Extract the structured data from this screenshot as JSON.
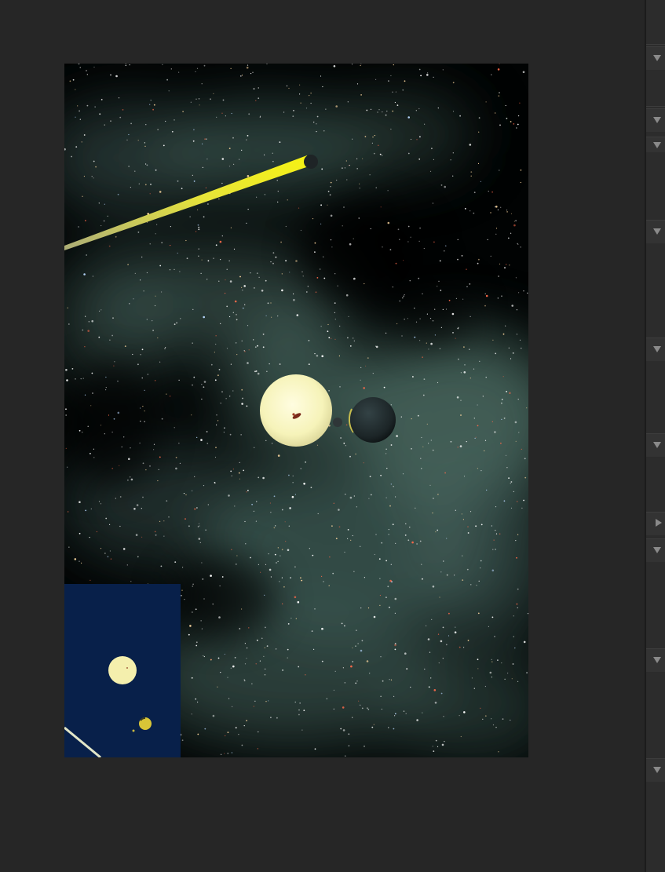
{
  "app": {
    "background": "#262626",
    "viewport_background": "#010303"
  },
  "viewport": {
    "name": "scene-viewport",
    "nebula_color": "#4f7068",
    "star_colors": [
      "#ffffff",
      "#ffd9a0",
      "#ff6a4a",
      "#b9d8ff"
    ],
    "objects": [
      {
        "name": "sun-sphere",
        "color": "#f6f3b9"
      },
      {
        "name": "dark-planet-sphere",
        "color": "#1f2a2c"
      },
      {
        "name": "small-moon-sphere",
        "color": "#2f3638"
      },
      {
        "name": "comet",
        "color": "#f2ee13"
      }
    ]
  },
  "minimap": {
    "background": "#08204a",
    "objects": [
      {
        "name": "minimap-sun-icon",
        "color": "#f4efad"
      },
      {
        "name": "minimap-planet-icon",
        "color": "#d8c537"
      },
      {
        "name": "minimap-comet-trail",
        "color": "#e2e6c8"
      }
    ]
  },
  "side_panel": {
    "sections": [
      {
        "name": "panel-section-1",
        "state": "expanded",
        "icon": "chevron-down-icon"
      },
      {
        "name": "panel-section-2",
        "state": "expanded",
        "icon": "chevron-down-icon"
      },
      {
        "name": "panel-section-3",
        "state": "expanded",
        "icon": "chevron-down-icon"
      },
      {
        "name": "panel-section-4",
        "state": "expanded",
        "icon": "chevron-down-icon"
      },
      {
        "name": "panel-section-5",
        "state": "expanded",
        "icon": "chevron-down-icon"
      },
      {
        "name": "panel-section-6",
        "state": "expanded",
        "icon": "chevron-down-icon"
      },
      {
        "name": "panel-section-7",
        "state": "collapsed",
        "icon": "chevron-right-icon"
      },
      {
        "name": "panel-section-8",
        "state": "expanded",
        "icon": "chevron-down-icon"
      },
      {
        "name": "panel-section-9",
        "state": "expanded",
        "icon": "chevron-down-icon"
      },
      {
        "name": "panel-section-10",
        "state": "expanded",
        "icon": "chevron-down-icon"
      }
    ]
  }
}
